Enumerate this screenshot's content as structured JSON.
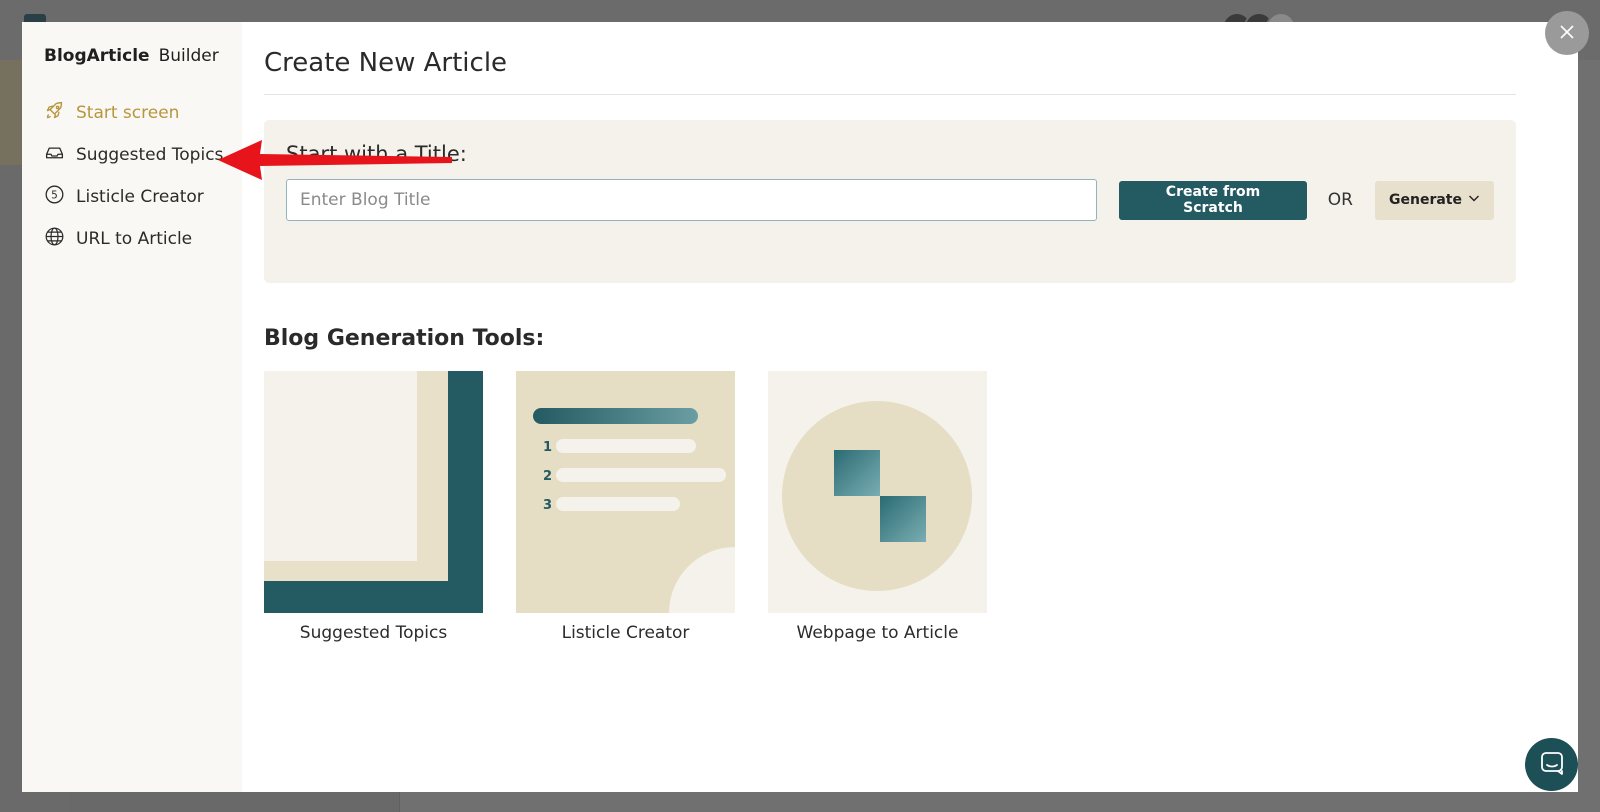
{
  "sidebar": {
    "brand_strong": "BlogArticle",
    "brand_light": "Builder",
    "items": [
      {
        "label": "Start screen",
        "icon": "rocket-icon",
        "active": true
      },
      {
        "label": "Suggested Topics",
        "icon": "inbox-icon",
        "active": false
      },
      {
        "label": "Listicle Creator",
        "icon": "number-five-circle-icon",
        "active": false
      },
      {
        "label": "URL to Article",
        "icon": "globe-icon",
        "active": false
      }
    ]
  },
  "main": {
    "title": "Create New Article",
    "title_panel": {
      "heading": "Start with a Title:",
      "input_placeholder": "Enter Blog Title",
      "input_value": "",
      "create_button": "Create from Scratch",
      "or_text": "OR",
      "generate_button": "Generate"
    },
    "tools_heading": "Blog Generation Tools:",
    "tools": [
      {
        "label": "Suggested Topics"
      },
      {
        "label": "Listicle Creator",
        "list_numbers": [
          "1",
          "2",
          "3"
        ]
      },
      {
        "label": "Webpage to Article"
      }
    ]
  },
  "colors": {
    "accent_gold": "#b8963f",
    "primary_teal": "#245a61",
    "panel_beige": "#f4f2ea",
    "annotation_red": "#e8141b"
  },
  "icons": {
    "close": "close-icon",
    "chat": "chat-icon",
    "generate_caret": "chevron-down-icon"
  }
}
